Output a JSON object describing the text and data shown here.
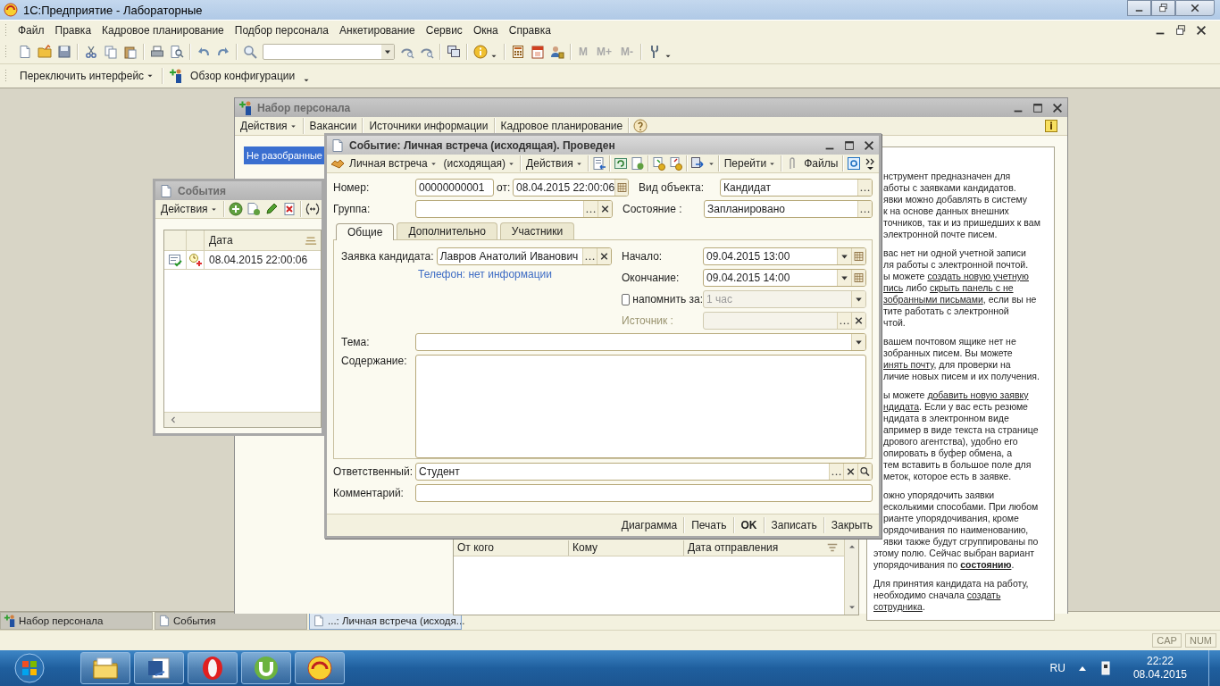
{
  "app": {
    "title": "1С:Предприятие - Лабораторные",
    "menu": [
      "Файл",
      "Правка",
      "Кадровое планирование",
      "Подбор персонала",
      "Анкетирование",
      "Сервис",
      "Окна",
      "Справка"
    ],
    "memory_buttons": [
      "M",
      "M+",
      "M-"
    ],
    "toolbar2": [
      {
        "label": "Переключить интерфейс",
        "dropdown": true
      },
      {
        "label": "Обзор конфигурации",
        "dropdown": true
      }
    ]
  },
  "nabor": {
    "title": "Набор персонала",
    "toolbar": [
      {
        "label": "Действия",
        "dropdown": true
      },
      {
        "label": "Вакансии",
        "dropdown": false
      },
      {
        "label": "Источники информации",
        "dropdown": false
      },
      {
        "label": "Кадровое планирование",
        "dropdown": false
      }
    ],
    "list": [
      {
        "label": "Не разобранные",
        "selected": true
      }
    ],
    "help": [
      {
        "lines": [
          {
            "clipped": true,
            "parts": [
              {
                "text": "нструмент предназначен для"
              }
            ]
          },
          {
            "clipped": true,
            "parts": [
              {
                "text": "аботы с заявками кандидатов."
              }
            ]
          },
          {
            "clipped": true,
            "parts": [
              {
                "text": "явки можно добавлять в систему"
              }
            ]
          },
          {
            "clipped": true,
            "parts": [
              {
                "text": "к на основе данных внешних"
              }
            ]
          },
          {
            "clipped": true,
            "parts": [
              {
                "text": "точников, так и из пришедших к вам"
              }
            ]
          },
          {
            "clipped": true,
            "parts": [
              {
                "text": "электронной почте писем."
              }
            ]
          }
        ]
      },
      {
        "lines": [
          {
            "clipped": true,
            "parts": [
              {
                "text": "вас нет ни одной учетной записи"
              }
            ]
          },
          {
            "clipped": true,
            "parts": [
              {
                "text": "ля работы с электронной почтой."
              }
            ]
          },
          {
            "clipped": true,
            "parts": [
              {
                "text": "ы можете "
              },
              {
                "text": "создать новую учетную",
                "link": true
              }
            ]
          },
          {
            "clipped": true,
            "parts": [
              {
                "text": "пись",
                "link": true
              },
              {
                "text": " либо "
              },
              {
                "text": "скрыть панель с не",
                "link": true
              }
            ]
          },
          {
            "clipped": true,
            "parts": [
              {
                "text": "зобранными письмами",
                "link": true
              },
              {
                "text": ", если вы не"
              }
            ]
          },
          {
            "clipped": true,
            "parts": [
              {
                "text": "тите работать с электронной"
              }
            ]
          },
          {
            "clipped": true,
            "parts": [
              {
                "text": "чтой."
              }
            ]
          }
        ]
      },
      {
        "lines": [
          {
            "clipped": true,
            "parts": [
              {
                "text": "вашем почтовом ящике нет не"
              }
            ]
          },
          {
            "clipped": true,
            "parts": [
              {
                "text": "зобранных писем. Вы можете"
              }
            ]
          },
          {
            "clipped": true,
            "parts": [
              {
                "text": "инять почту",
                "link": true
              },
              {
                "text": ", для проверки на"
              }
            ]
          },
          {
            "clipped": true,
            "parts": [
              {
                "text": "личие новых писем и их получения."
              }
            ]
          }
        ]
      },
      {
        "lines": [
          {
            "clipped": true,
            "parts": [
              {
                "text": "ы можете "
              },
              {
                "text": "добавить новую заявку",
                "link": true
              }
            ]
          },
          {
            "clipped": true,
            "parts": [
              {
                "text": "ндидата",
                "link": true
              },
              {
                "text": ". Если у вас есть резюме"
              }
            ]
          },
          {
            "clipped": true,
            "parts": [
              {
                "text": "ндидата в электронном виде"
              }
            ]
          },
          {
            "clipped": true,
            "parts": [
              {
                "text": "апример в виде текста на странице"
              }
            ]
          },
          {
            "clipped": true,
            "parts": [
              {
                "text": "дрового агентства), удобно его"
              }
            ]
          },
          {
            "clipped": true,
            "parts": [
              {
                "text": "опировать в буфер обмена, а"
              }
            ]
          },
          {
            "clipped": true,
            "parts": [
              {
                "text": "тем вставить в большое поле для"
              }
            ]
          },
          {
            "clipped": true,
            "parts": [
              {
                "text": "меток, которое есть в заявке."
              }
            ]
          }
        ]
      },
      {
        "lines": [
          {
            "clipped": true,
            "parts": [
              {
                "text": "ожно упорядочить заявки"
              }
            ]
          },
          {
            "clipped": true,
            "parts": [
              {
                "text": "есколькими способами. При любом"
              }
            ]
          },
          {
            "clipped": true,
            "parts": [
              {
                "text": "рианте упорядочивания, кроме"
              }
            ]
          },
          {
            "clipped": true,
            "parts": [
              {
                "text": "орядочивания по наименованию,"
              }
            ]
          },
          {
            "clipped": true,
            "parts": [
              {
                "text": "явки также будут сгруппированы по"
              }
            ]
          },
          {
            "clipped": false,
            "parts": [
              {
                "text": "этому полю. Сейчас выбран вариант"
              }
            ]
          },
          {
            "clipped": false,
            "parts": [
              {
                "text": "упорядочивания по "
              },
              {
                "text": "состоянию",
                "link": true,
                "bold": true
              },
              {
                "text": "."
              }
            ]
          }
        ]
      },
      {
        "lines": [
          {
            "clipped": false,
            "parts": [
              {
                "text": "Для принятия кандидата на работу,"
              }
            ]
          },
          {
            "clipped": false,
            "parts": [
              {
                "text": "необходимо сначала "
              },
              {
                "text": "создать",
                "link": true
              }
            ]
          },
          {
            "clipped": false,
            "parts": [
              {
                "text": "сотрудника",
                "link": true
              },
              {
                "text": "."
              }
            ]
          }
        ]
      }
    ],
    "mail_table": {
      "columns": [
        "От кого",
        "Кому",
        "Дата отправления"
      ]
    }
  },
  "events": {
    "title": "События",
    "toolbar": [
      {
        "label": "Действия",
        "dropdown": true
      }
    ],
    "columns": [
      "Дата"
    ],
    "rows": [
      {
        "date": "08.04.2015 22:00:06"
      }
    ]
  },
  "dialog": {
    "title": "Событие: Личная встреча (исходящая). Проведен",
    "toolbar": [
      {
        "label": "Личная встреча",
        "dropdown": true
      },
      {
        "label": "(исходящая)",
        "dropdown": true
      },
      {
        "label": "Действия",
        "dropdown": true
      },
      {
        "label": "Перейти",
        "dropdown": true
      },
      {
        "label": "Файлы",
        "dropdown": false
      }
    ],
    "number": {
      "label": "Номер:",
      "value": "00000000001"
    },
    "date": {
      "label": "от:",
      "value": "08.04.2015 22:00:06"
    },
    "object_type": {
      "label": "Вид объекта:",
      "value": "Кандидат"
    },
    "group": {
      "label": "Группа:"
    },
    "state": {
      "label": "Состояние :",
      "value": "Запланировано"
    },
    "tabs": [
      {
        "label": "Общие",
        "selected": true
      },
      {
        "label": "Дополнительно",
        "selected": false
      },
      {
        "label": "Участники",
        "selected": false
      }
    ],
    "candidate": {
      "label": "Заявка кандидата:",
      "value": "Лавров Анатолий Иванович"
    },
    "phone_link": "Телефон: нет информации",
    "start": {
      "label": "Начало:",
      "value": "09.04.2015 13:00"
    },
    "end": {
      "label": "Окончание:",
      "value": "09.04.2015 14:00"
    },
    "remind": {
      "label": "напомнить за:",
      "checked": false,
      "value": "1 час",
      "disabled": true
    },
    "source": {
      "label": "Источник :",
      "disabled": true
    },
    "topic": {
      "label": "Тема:"
    },
    "content": {
      "label": "Содержание:"
    },
    "responsible": {
      "label": "Ответственный:",
      "value": "Студент"
    },
    "comment": {
      "label": "Комментарий:"
    },
    "buttons": [
      {
        "label": "Диаграмма",
        "default": false
      },
      {
        "label": "Печать",
        "default": false
      },
      {
        "label": "OK",
        "default": true
      },
      {
        "label": "Записать",
        "default": false
      },
      {
        "label": "Закрыть",
        "default": false
      }
    ]
  },
  "window_bar": [
    {
      "label": "Набор персонала",
      "selected": false
    },
    {
      "label": "События",
      "selected": false
    },
    {
      "label": "...: Личная встреча (исходя...",
      "selected": true
    }
  ],
  "status": [
    "CAP",
    "NUM"
  ],
  "tray": {
    "lang": "RU",
    "time": "22:22",
    "date": "08.04.2015"
  }
}
